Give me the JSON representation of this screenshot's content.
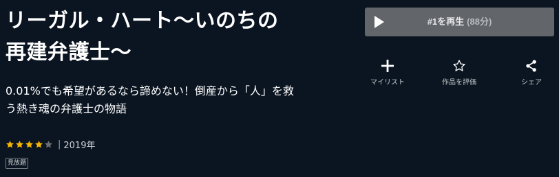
{
  "title": {
    "line1": "リーガル・ハート〜いのちの",
    "line2": "再建弁護士〜"
  },
  "catchphrase": {
    "line1": "0.01%でも希望があるなら諦めない！倒産から「人」を救",
    "line2": "う熱き魂の弁護士の物語"
  },
  "meta": {
    "rating": 4,
    "rating_max": 5,
    "separator": "|",
    "year": "2019年",
    "star_color": "#f5b400",
    "star_empty_color": "#6b6f74"
  },
  "badge": {
    "label": "見放題"
  },
  "play_button": {
    "label": "#1を再生",
    "duration": "(88分)",
    "icon": "play-icon"
  },
  "actions": [
    {
      "label": "マイリスト",
      "icon": "plus-icon"
    },
    {
      "label": "作品を評価",
      "icon": "star-outline-icon"
    },
    {
      "label": "シェア",
      "icon": "share-icon"
    }
  ]
}
